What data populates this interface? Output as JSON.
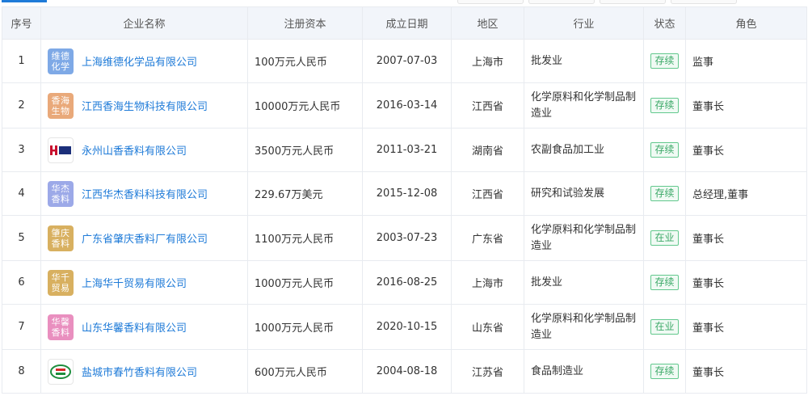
{
  "headers": {
    "no": "序号",
    "name": "企业名称",
    "capital": "注册资本",
    "date": "成立日期",
    "region": "地区",
    "industry": "行业",
    "status": "状态",
    "role": "角色"
  },
  "rows": [
    {
      "no": "1",
      "logo": "维德化学",
      "logo_color": "#7ea9e6",
      "name": "上海维德化学品有限公司",
      "capital": "100万元人民币",
      "date": "2007-07-03",
      "region": "上海市",
      "industry": "批发业",
      "status": "存续",
      "role": "监事"
    },
    {
      "no": "2",
      "logo": "香海生物",
      "logo_color": "#e9a97a",
      "name": "江西香海生物科技有限公司",
      "capital": "10000万元人民币",
      "date": "2016-03-14",
      "region": "江西省",
      "industry": "化学原料和化学制品制造业",
      "status": "存续",
      "role": "董事长"
    },
    {
      "no": "3",
      "logo": "",
      "logo_color": "#ffffff",
      "name": "永州山香香料有限公司",
      "capital": "3500万元人民币",
      "date": "2011-03-21",
      "region": "湖南省",
      "industry": "农副食品加工业",
      "status": "存续",
      "role": "董事长"
    },
    {
      "no": "4",
      "logo": "华杰香料",
      "logo_color": "#9ca9e8",
      "name": "江西华杰香料科技有限公司",
      "capital": "229.67万美元",
      "date": "2015-12-08",
      "region": "江西省",
      "industry": "研究和试验发展",
      "status": "存续",
      "role": "总经理,董事"
    },
    {
      "no": "5",
      "logo": "肇庆香料",
      "logo_color": "#d8b060",
      "name": "广东省肇庆香料厂有限公司",
      "capital": "1100万元人民币",
      "date": "2003-07-23",
      "region": "广东省",
      "industry": "化学原料和化学制品制造业",
      "status": "在业",
      "role": "董事长"
    },
    {
      "no": "6",
      "logo": "华千贸易",
      "logo_color": "#d8b060",
      "name": "上海华千贸易有限公司",
      "capital": "1000万元人民币",
      "date": "2016-08-25",
      "region": "上海市",
      "industry": "批发业",
      "status": "存续",
      "role": "董事长"
    },
    {
      "no": "7",
      "logo": "华馨香料",
      "logo_color": "#e98fbf",
      "name": "山东华馨香料有限公司",
      "capital": "1000万元人民币",
      "date": "2020-10-15",
      "region": "山东省",
      "industry": "化学原料和化学制品制造业",
      "status": "在业",
      "role": "董事长"
    },
    {
      "no": "8",
      "logo": "",
      "logo_color": "#ffffff",
      "name": "盐城市春竹香料有限公司",
      "capital": "600万元人民币",
      "date": "2004-08-18",
      "region": "江苏省",
      "industry": "食品制造业",
      "status": "存续",
      "role": "董事长"
    }
  ],
  "colors": {
    "accent": "#1f7bd8",
    "status_green": "#3aa866"
  }
}
